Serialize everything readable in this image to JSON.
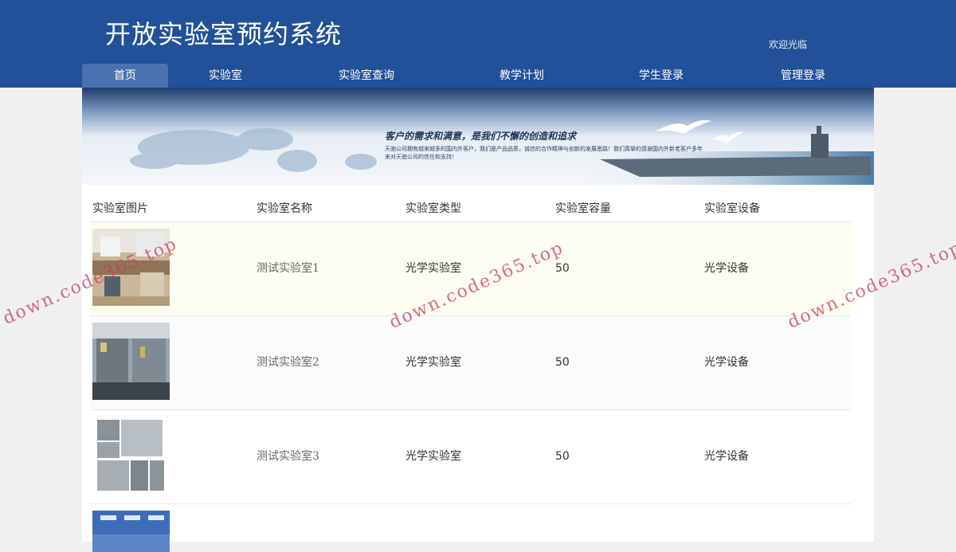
{
  "header": {
    "title": "开放实验室预约系统",
    "welcome": "欢迎光临"
  },
  "nav": {
    "items": [
      {
        "label": "首页",
        "active": true
      },
      {
        "label": "实验室",
        "active": false
      },
      {
        "label": "实验室查询",
        "active": false
      },
      {
        "label": "教学计划",
        "active": false
      },
      {
        "label": "学生登录",
        "active": false
      },
      {
        "label": "管理登录",
        "active": false
      }
    ]
  },
  "banner": {
    "slogan": "客户的需求和满意，是我们不懈的创造和追求",
    "subtext": "天驰公司拥有越来越多的国内外客户，我们是产品品质，诚信的合作精神与创新的发展思路！我们真挚的感谢国内外新老客户多年来对天驰公司的信任和支持！"
  },
  "table": {
    "headers": [
      "实验室图片",
      "实验室名称",
      "实验室类型",
      "实验室容量",
      "实验室设备"
    ],
    "rows": [
      {
        "name": "测试实验室1",
        "type": "光学实验室",
        "capacity": "50",
        "equipment": "光学设备"
      },
      {
        "name": "测试实验室2",
        "type": "光学实验室",
        "capacity": "50",
        "equipment": "光学设备"
      },
      {
        "name": "测试实验室3",
        "type": "光学实验室",
        "capacity": "50",
        "equipment": "光学设备"
      }
    ]
  },
  "watermark": "down.code365.top",
  "colors": {
    "header_bg": "#22519a",
    "nav_active": "#4b72b0",
    "page_bg": "#f0f0f2"
  }
}
